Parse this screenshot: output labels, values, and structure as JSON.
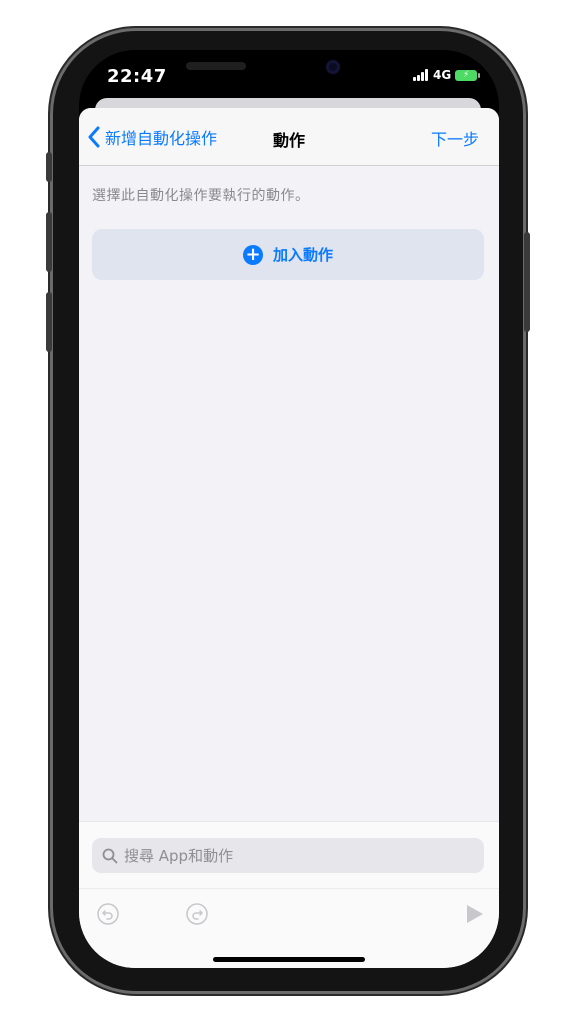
{
  "status_bar": {
    "time": "22:47",
    "network": "4G"
  },
  "navbar": {
    "back_label": "新增自動化操作",
    "title": "動作",
    "next_label": "下一步"
  },
  "main": {
    "instruction": "選擇此自動化操作要執行的動作。",
    "add_action_label": "加入動作"
  },
  "bottom": {
    "search_placeholder": "搜尋 App和動作"
  },
  "icons": {
    "back": "chevron-left-icon",
    "add": "plus-circle-icon",
    "search": "search-icon",
    "undo": "undo-icon",
    "redo": "redo-icon",
    "run": "play-icon"
  },
  "colors": {
    "accent": "#0a7aff",
    "background": "#f2f2f7",
    "add_button_bg": "#dfe4ee",
    "battery": "#4cd964"
  }
}
